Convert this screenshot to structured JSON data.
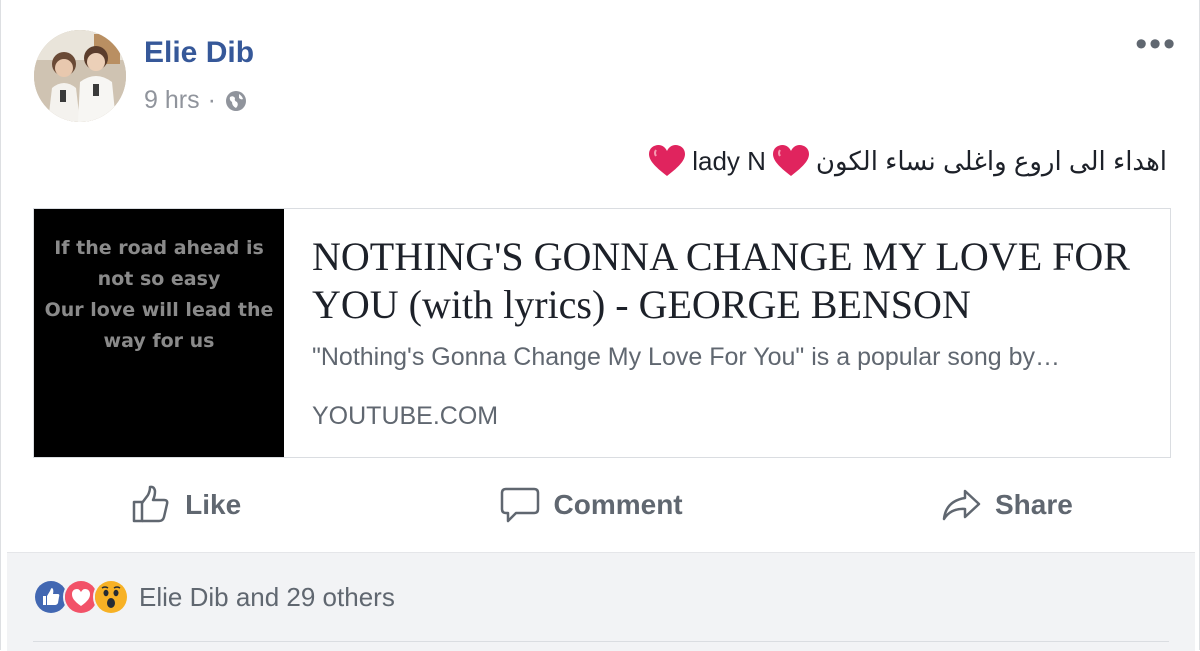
{
  "post": {
    "author": "Elie Dib",
    "timestamp": "9 hrs",
    "separator": "·",
    "privacy_icon": "globe-icon",
    "more_label": "•••",
    "message": {
      "arabic_text": "اهداء الى اروع واغلى نساء الكون",
      "name": "lady N",
      "emoji": "red-heart-icon"
    }
  },
  "link_card": {
    "thumbnail_lyrics": [
      "If the road ahead is",
      "not so easy",
      "Our love will lead the",
      "way for us"
    ],
    "title": "NOTHING'S GONNA CHANGE MY LOVE FOR YOU (with lyrics) - GEORGE BENSON",
    "description": "\"Nothing's Gonna Change My Love For You\" is a popular song by…",
    "domain": "YOUTUBE.COM"
  },
  "actions": {
    "like": "Like",
    "comment": "Comment",
    "share": "Share"
  },
  "reactions": {
    "icons": [
      "like-icon",
      "love-icon",
      "wow-icon"
    ],
    "summary": "Elie Dib and 29 others"
  },
  "colors": {
    "author_link": "#365899",
    "secondary_text": "#606770",
    "like_blue": "#4267b2",
    "love_red": "#f25268",
    "wow_yellow": "#f7b125"
  }
}
